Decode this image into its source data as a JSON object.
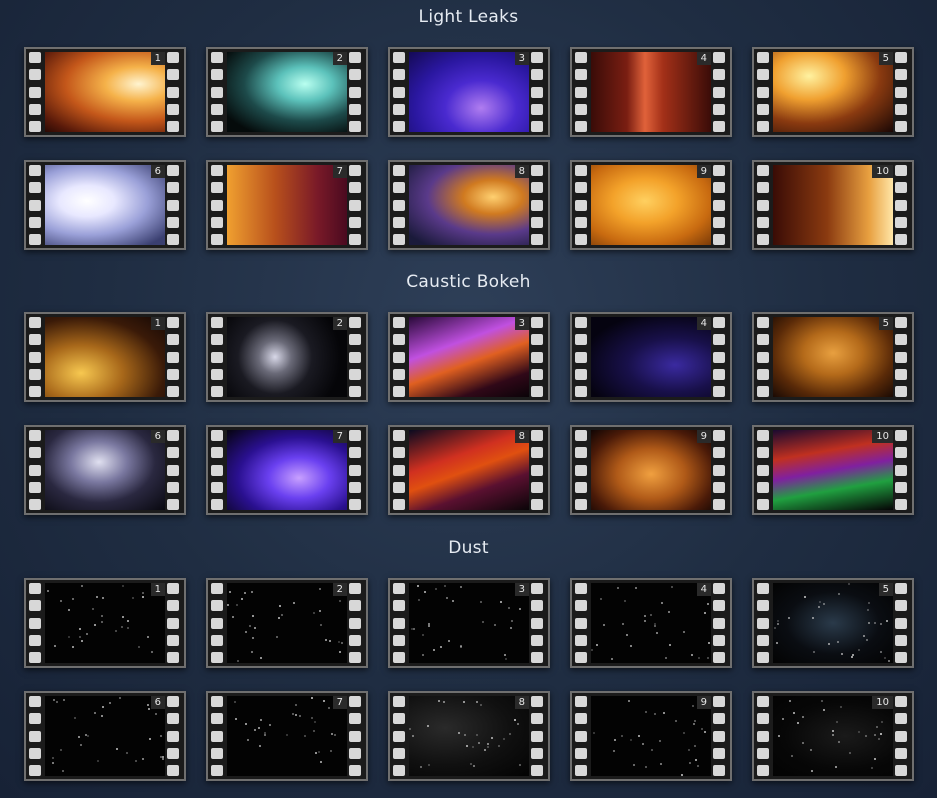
{
  "sections": [
    {
      "title": "Light Leaks",
      "items": [
        {
          "number": "1",
          "bg": "radial-gradient(ellipse at 78% 40%, #fff4d0 0%, #f5b24a 25%, #c4571a 55%, #5a1a0a 85%, #2a0a05 100%)"
        },
        {
          "number": "2",
          "bg": "radial-gradient(ellipse at 65% 40%, #b9fff0 0%, #5cc2bb 25%, #1d4a4a 55%, #050b0b 85%)"
        },
        {
          "number": "3",
          "bg": "radial-gradient(ellipse at 60% 70%, #b07df0 0%, #4a2ad0 35%, #2a17a0 65%, #140a55 100%)"
        },
        {
          "number": "4",
          "bg": "linear-gradient(90deg, #3a0c08 0%, #7a1e12 30%, #e0623a 45%, #a33018 60%, #3a0c08 100%)"
        },
        {
          "number": "5",
          "bg": "radial-gradient(ellipse at 30% 30%, #fff2a0 0%, #f0a030 30%, #8a3a10 60%, #1a0705 100%)"
        },
        {
          "number": "6",
          "bg": "radial-gradient(ellipse at 35% 45%, #ffffff 0%, #e8e8ff 25%, #9aa0d8 55%, #3a3f70 90%)"
        },
        {
          "number": "7",
          "bg": "linear-gradient(90deg, #f0a030 0%, #b8501c 40%, #7a1a28 75%, #4a0a20 100%)"
        },
        {
          "number": "8",
          "bg": "radial-gradient(ellipse at 70% 40%, #ffd070 0%, #d07a20 25%, #5a3a8a 55%, #1a1a3a 90%)"
        },
        {
          "number": "9",
          "bg": "radial-gradient(ellipse at 45% 45%, #ffd060 0%, #f3a22a 35%, #c86a10 70%, #7a3a08 100%)"
        },
        {
          "number": "10",
          "bg": "linear-gradient(90deg, #3a0c06 0%, #8a3a10 45%, #e8a040 80%, #ffe6a8 100%)"
        }
      ]
    },
    {
      "title": "Caustic Bokeh",
      "items": [
        {
          "number": "1",
          "bg": "radial-gradient(ellipse at 30% 70%, #f7c850 0%, #a8681a 35%, #3a1a08 70%, #150805 100%)"
        },
        {
          "number": "2",
          "bg": "radial-gradient(circle at 40% 50%, #d8d8e8 0%, #6a6a78 20%, #1a1a22 45%, #050508 80%)"
        },
        {
          "number": "3",
          "bg": "linear-gradient(160deg, #2a0a3a 0%, #c050e0 35%, #e06020 55%, #300818 80%, #0a0308 100%)"
        },
        {
          "number": "4",
          "bg": "radial-gradient(ellipse at 70% 60%, #3a2aa0 0%, #18104a 40%, #050310 80%)"
        },
        {
          "number": "5",
          "bg": "radial-gradient(ellipse at 50% 45%, #e8a040 0%, #b46a1a 35%, #5a2a08 70%, #1a0a04 100%)"
        },
        {
          "number": "6",
          "bg": "radial-gradient(ellipse at 45% 40%, #e0e0f0 0%, #7a78a0 30%, #2a2840 60%, #08080f 100%)"
        },
        {
          "number": "7",
          "bg": "radial-gradient(ellipse at 60% 60%, #c8a0ff 0%, #6a40f0 30%, #2a1090 60%, #05030f 100%)"
        },
        {
          "number": "8",
          "bg": "linear-gradient(160deg, #0a0a20 0%, #d03020 35%, #e05010 50%, #5a1030 70%, #0a0508 100%)"
        },
        {
          "number": "9",
          "bg": "radial-gradient(ellipse at 50% 55%, #f0a040 0%, #b05a18 40%, #4a1a08 75%, #100504 100%)"
        },
        {
          "number": "10",
          "bg": "linear-gradient(170deg, #1a0a30 0%, #c03020 30%, #8020a0 50%, #20a040 70%, #050305 100%)"
        }
      ]
    },
    {
      "title": "Dust",
      "items": [
        {
          "number": "1",
          "bg": "#030303"
        },
        {
          "number": "2",
          "bg": "#030303"
        },
        {
          "number": "3",
          "bg": "#030303"
        },
        {
          "number": "4",
          "bg": "#030303"
        },
        {
          "number": "5",
          "bg": "radial-gradient(ellipse at 50% 50%, #2a3a4a 0%, #0a0d12 55%, #030303 100%)"
        },
        {
          "number": "6",
          "bg": "#030303"
        },
        {
          "number": "7",
          "bg": "#030303"
        },
        {
          "number": "8",
          "bg": "radial-gradient(ellipse at 30% 40%, #2a2a2a 0%, #101010 55%, #030303 100%)"
        },
        {
          "number": "9",
          "bg": "#030303"
        },
        {
          "number": "10",
          "bg": "radial-gradient(ellipse at 60% 50%, #1a1a1a 0%, #070707 60%, #030303 100%)"
        }
      ]
    }
  ]
}
